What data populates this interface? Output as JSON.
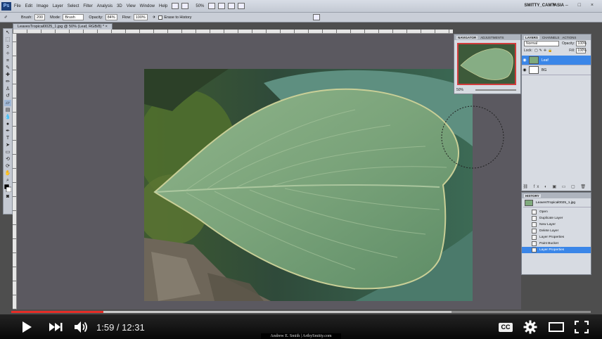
{
  "app": {
    "logo": "Ps",
    "menu": [
      "File",
      "Edit",
      "Image",
      "Layer",
      "Select",
      "Filter",
      "Analysis",
      "3D",
      "View",
      "Window",
      "Help"
    ],
    "zoom": "50%",
    "workspace": "SMITTY_CAMTASIA",
    "window_controls": "▾ – □ ×"
  },
  "options_bar": {
    "brush_label": "Brush:",
    "brush_size": "200",
    "mode_label": "Mode:",
    "mode_value": "Brush",
    "opacity_label": "Opacity:",
    "opacity_value": "84%",
    "flow_label": "Flow:",
    "flow_value": "100%",
    "erase_history_label": "Erase to History"
  },
  "document": {
    "tab_title": "LeavesTropical0025_1.jpg @ 50% (Leaf, RGB/8) *  ×"
  },
  "navigator": {
    "tabs": [
      "NAVIGATOR",
      "ADJUSTMENTS"
    ],
    "zoom": "50%"
  },
  "layers": {
    "tabs": [
      "LAYERS",
      "CHANNELS",
      "ACTIONS"
    ],
    "blend_mode": "Normal",
    "opacity_label": "Opacity:",
    "opacity_value": "100%",
    "lock_label": "Lock:",
    "fill_label": "Fill:",
    "fill_value": "100%",
    "items": [
      {
        "name": "Leaf",
        "selected": true
      },
      {
        "name": "BG",
        "selected": false
      }
    ],
    "footer_icons": "⛓ fx ◐ ▣ ▭ ▢ 🗑"
  },
  "history": {
    "tab": "HISTORY",
    "snapshot": "LeavesTropical0025_1.jpg",
    "steps": [
      {
        "label": "Open",
        "selected": false
      },
      {
        "label": "Duplicate Layer",
        "selected": false
      },
      {
        "label": "New Layer",
        "selected": false
      },
      {
        "label": "Delete Layer",
        "selected": false
      },
      {
        "label": "Layer Properties",
        "selected": false
      },
      {
        "label": "Paint Bucket",
        "selected": false
      },
      {
        "label": "Layer Properties",
        "selected": true
      }
    ]
  },
  "player": {
    "current_time": "1:59",
    "duration": "12:31",
    "time_display": "1:59 / 12:31",
    "played_fraction": 0.159,
    "loaded_fraction": 0.76,
    "cc_label": "CC",
    "watermark": "Andrew E. Smith | ArtbySmitty.com",
    "colors": {
      "played": "#e52d27"
    }
  }
}
